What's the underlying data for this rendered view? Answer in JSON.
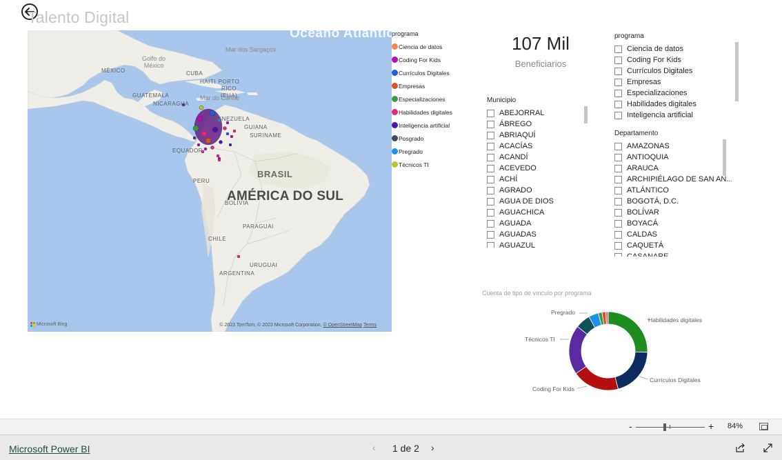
{
  "report": {
    "title": "Talento Digital",
    "back_icon": "back-arrow-icon"
  },
  "map": {
    "labels": {
      "ocean": "Oceano Atlântico",
      "mar_sargacos": "Mar dos Sargaços",
      "golfo": "Golfo do México",
      "mexico": "MÉXICO",
      "cuba": "CUBA",
      "haiti": "HAITI",
      "porto_rico": "PORTO RICO (EUA)",
      "guatemala": "GUATEMALA",
      "nicaragua": "NICARAGUA",
      "mar_caribe": "Mar do Caribe",
      "venezuela": "VENEZUELA",
      "guiana": "GUIANA",
      "suriname": "SURINAME",
      "equador": "EQUADOR",
      "peru": "PERU",
      "brasil": "BRASIL",
      "continent": "AMÉRICA DO SUL",
      "bolivia": "BOLÍVIA",
      "paraguai": "PARAGUAI",
      "chile": "CHILE",
      "uruguai": "URUGUAI",
      "argentina": "ARGENTINA"
    },
    "brand": "Microsoft Bing",
    "copyright": "© 2023 TomTom, © 2023 Microsoft Corporation,",
    "copyright_link": "© OpenStreetMap",
    "terms": "Terms"
  },
  "legend": {
    "title": "programa",
    "items": [
      {
        "label": "Ciencia de datos",
        "color": "#f2874c"
      },
      {
        "label": "Coding For Kids",
        "color": "#b40fa8"
      },
      {
        "label": "Currículos Digitales",
        "color": "#1d5ed6"
      },
      {
        "label": "Empresas",
        "color": "#d9531e"
      },
      {
        "label": "Especializaciones",
        "color": "#3a9b46"
      },
      {
        "label": "Habilidades digitales",
        "color": "#e0297a"
      },
      {
        "label": "Inteligencia artificial",
        "color": "#4b19a8"
      },
      {
        "label": "Posgrado",
        "color": "#3b4a5c"
      },
      {
        "label": "Pregrado",
        "color": "#1a90ea"
      },
      {
        "label": "Técnicos TI",
        "color": "#b7c72a"
      }
    ]
  },
  "kpi": {
    "value": "107 Mil",
    "label": "Beneficiarios"
  },
  "slicer_programa": {
    "title": "programa",
    "items": [
      "Ciencia de datos",
      "Coding For Kids",
      "Currículos Digitales",
      "Empresas",
      "Especializaciones",
      "Habilidades digitales",
      "Inteligencia artificial"
    ]
  },
  "slicer_municipio": {
    "title": "Municipio",
    "items": [
      "ABEJORRAL",
      "ÁBREGO",
      "ABRIAQUÍ",
      "ACACÍAS",
      "ACANDÍ",
      "ACEVEDO",
      "ACHÍ",
      "AGRADO",
      "AGUA DE DIOS",
      "AGUACHICA",
      "AGUADA",
      "AGUADAS",
      "AGUAZUL"
    ]
  },
  "slicer_departamento": {
    "title": "Departamento",
    "items": [
      "AMAZONAS",
      "ANTIOQUIA",
      "ARAUCA",
      "ARCHIPIÉLAGO DE SAN AN...",
      "ATLÁNTICO",
      "BOGOTÁ, D.C.",
      "BOLÍVAR",
      "BOYACÁ",
      "CALDAS",
      "CAQUETÁ",
      "CASANARE"
    ]
  },
  "donut": {
    "title": "Cuenta de tipo de vínculo por programa",
    "labels": {
      "habilidades": "Habilidades digitales",
      "curriculos": "Currículos Digitales",
      "coding": "Coding For Kids",
      "tecnicos": "Técnicos TI",
      "pregrado": "Pregrado"
    }
  },
  "chart_data": {
    "type": "pie",
    "title": "Cuenta de tipo de vínculo por programa",
    "categories": [
      "Habilidades digitales",
      "Currículos Digitales",
      "Coding For Kids",
      "Técnicos TI",
      "Posgrado",
      "Pregrado",
      "Especializaciones",
      "Empresas",
      "Ciencia de datos"
    ],
    "values": [
      25,
      20,
      19,
      20,
      6,
      4,
      1.5,
      1.5,
      1
    ],
    "colors": [
      "#1e8c1e",
      "#0d2b5e",
      "#b50f0f",
      "#5a2aa3",
      "#0f5158",
      "#1a90ea",
      "#3a9b46",
      "#d9531e",
      "#e66a8f"
    ],
    "donut": true
  },
  "zoom": {
    "minus": "-",
    "plus": "+",
    "percent": "84%"
  },
  "footer": {
    "link": "Microsoft Power BI",
    "page": "1 de 2",
    "prev": "‹",
    "next": "›"
  }
}
